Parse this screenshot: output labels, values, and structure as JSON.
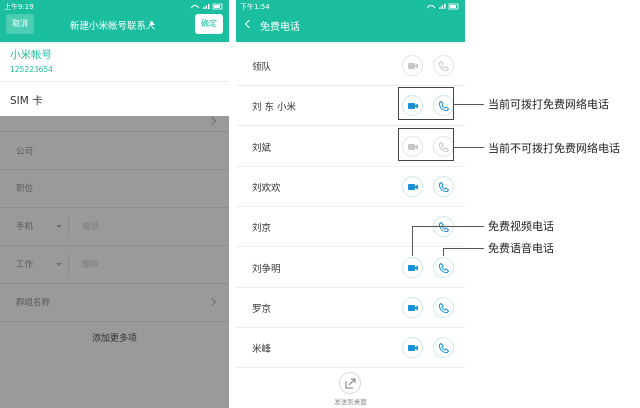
{
  "left_screen": {
    "status_time": "上午9:19",
    "cancel_label": "取消",
    "title": "新建小米帐号联系人",
    "confirm_label": "确定",
    "account_label": "小米帐号",
    "account_id": "125223654",
    "sim_label": "SIM 卡",
    "company_placeholder": "公司",
    "position_placeholder": "职位",
    "phone_type": "手机",
    "phone_placeholder": "电话",
    "email_type": "工作",
    "email_placeholder": "邮件",
    "group_label": "群组名称",
    "add_more_label": "添加更多项"
  },
  "right_screen": {
    "status_time": "下午1:54",
    "title": "免费电话",
    "contacts": [
      {
        "name": "领队",
        "video": "inactive",
        "voice": "inactive"
      },
      {
        "name": "刘 东 小米",
        "video": "active",
        "voice": "active"
      },
      {
        "name": "刘斌",
        "video": "inactive",
        "voice": "inactive"
      },
      {
        "name": "刘欢欢",
        "video": "active",
        "voice": "active"
      },
      {
        "name": "刘京",
        "video": "none",
        "voice": "active"
      },
      {
        "name": "刘争明",
        "video": "active",
        "voice": "active"
      },
      {
        "name": "罗京",
        "video": "active",
        "voice": "active"
      },
      {
        "name": "米峰",
        "video": "active",
        "voice": "active"
      }
    ],
    "send_to_desktop_label": "发送到桌面"
  },
  "annotations": {
    "can_call": "当前可拨打免费网络电话",
    "cannot_call": "当前不可拨打免费网络电话",
    "video_call": "免费视频电话",
    "voice_call": "免费语音电话"
  },
  "colors": {
    "accent": "#1bbf9f",
    "icon_active": "#1a8fd8",
    "icon_inactive": "#c6c6c6",
    "overlay": "#9a9a9a"
  }
}
